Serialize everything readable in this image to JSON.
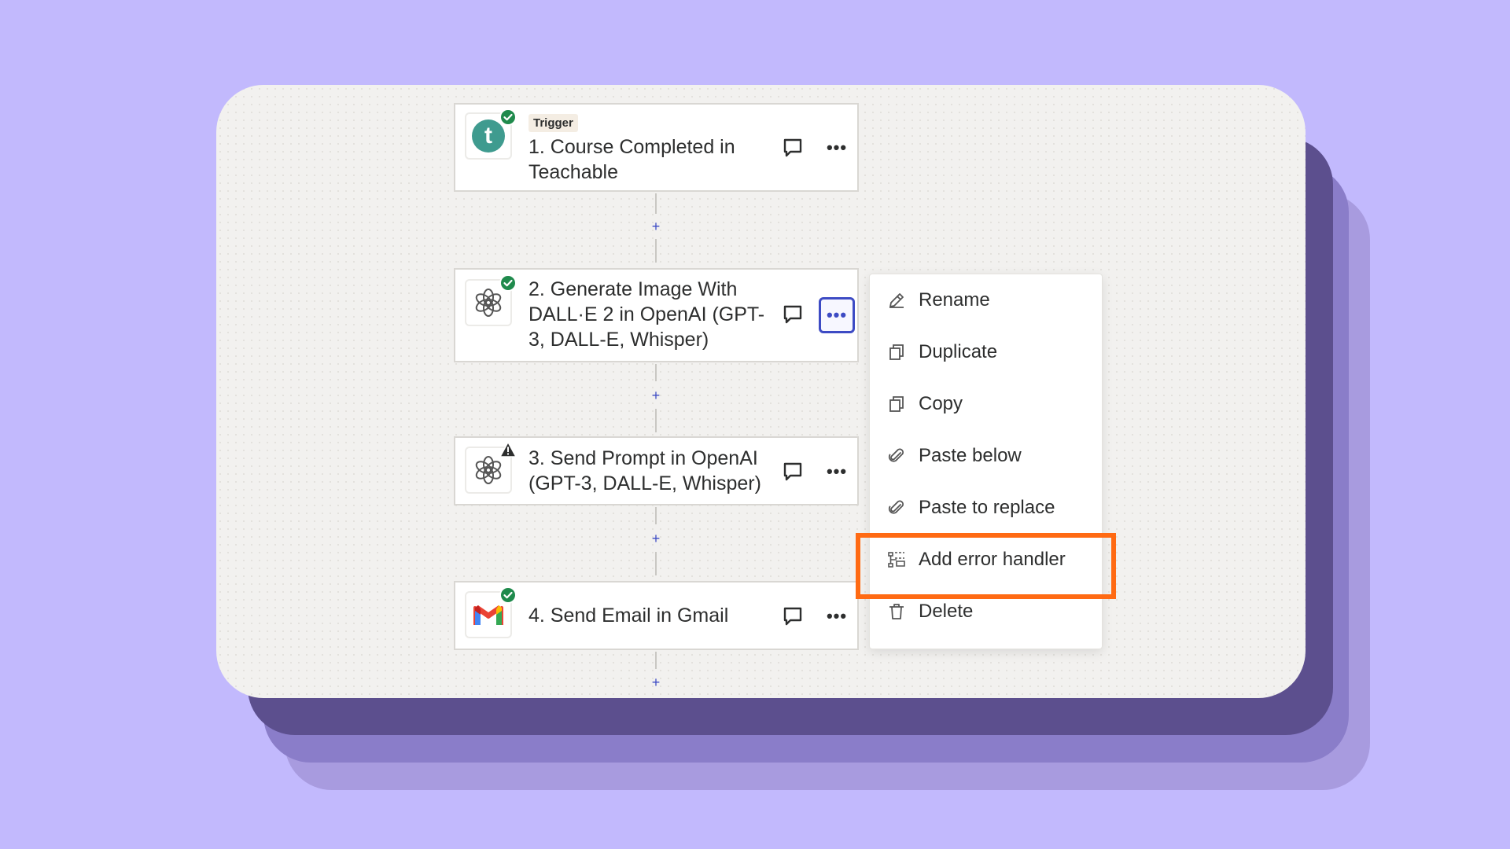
{
  "steps": [
    {
      "number_title": "1. Course Completed in Teachable",
      "trigger_label": "Trigger",
      "app": "teachable-icon",
      "status": "success"
    },
    {
      "number_title": "2. Generate Image With DALL·E 2 in OpenAI (GPT-3, DALL-E, Whisper)",
      "app": "openai-icon",
      "status": "success"
    },
    {
      "number_title": "3. Send Prompt in OpenAI (GPT-3, DALL-E, Whisper)",
      "app": "openai-icon",
      "status": "warning"
    },
    {
      "number_title": "4. Send Email in Gmail",
      "app": "gmail-icon",
      "status": "success"
    }
  ],
  "teachable_letter": "t",
  "more_glyph": "•••",
  "plus_glyph": "+",
  "menu": {
    "items": [
      {
        "label": "Rename",
        "icon": "pencil-icon"
      },
      {
        "label": "Duplicate",
        "icon": "duplicate-icon"
      },
      {
        "label": "Copy",
        "icon": "copy-icon"
      },
      {
        "label": "Paste below",
        "icon": "paperclip-icon"
      },
      {
        "label": "Paste to replace",
        "icon": "paperclip-icon"
      },
      {
        "label": "Add error handler",
        "icon": "error-handler-icon",
        "highlighted": true
      },
      {
        "label": "Delete",
        "icon": "trash-icon"
      }
    ]
  },
  "colors": {
    "background": "#c2b9fd",
    "accent": "#3d4bc4",
    "highlight": "#ff6a13",
    "success": "#1f8a4c",
    "teachable": "#3f9b8f"
  }
}
